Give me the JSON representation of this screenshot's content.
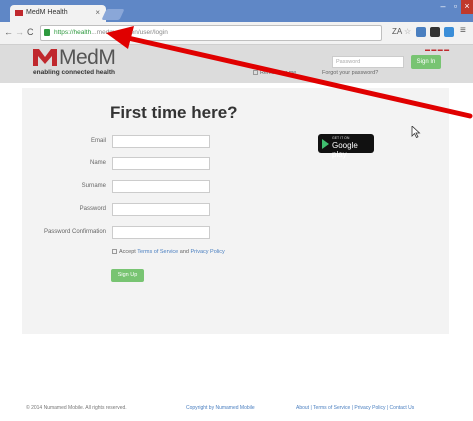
{
  "browser": {
    "tab_title": "MedM Health",
    "tab_close": "×",
    "window_controls": {
      "minimize": "–",
      "maximize": "▫",
      "close": "×"
    },
    "nav": {
      "back": "←",
      "forward": "→",
      "reload": "C"
    },
    "url_secure_part": "https://health",
    "url_rest": "...medm.com/en/user/login",
    "zoom_icon": "ZA",
    "star_icon": "☆",
    "menu_icon": "≡"
  },
  "header": {
    "logo_text": "MedM",
    "tagline": "enabling connected health",
    "password_placeholder": "Password",
    "signin_label": "Sign In",
    "remember_label": "Remember me",
    "forgot_label": "Forgot your password?",
    "colors": {
      "brand_red": "#c0282d",
      "green": "#78c472"
    }
  },
  "signup_form": {
    "heading": "First time here?",
    "fields": [
      {
        "label": "Email"
      },
      {
        "label": "Name"
      },
      {
        "label": "Surname"
      },
      {
        "label": "Password"
      },
      {
        "label": "Password Confirmation"
      }
    ],
    "accept_prefix": "Accept",
    "terms_link": "Terms of Service",
    "and_text": "and",
    "privacy_link": "Privacy Policy",
    "signup_label": "Sign Up",
    "google_play_small": "GET IT ON",
    "google_play_big": "Google play"
  },
  "footer": {
    "copyright": "© 2014 Numamed Mobile. All rights reserved.",
    "middle": "Copyright by Numamed Mobile",
    "links": "About | Terms of Service | Privacy Policy | Contact Us"
  }
}
